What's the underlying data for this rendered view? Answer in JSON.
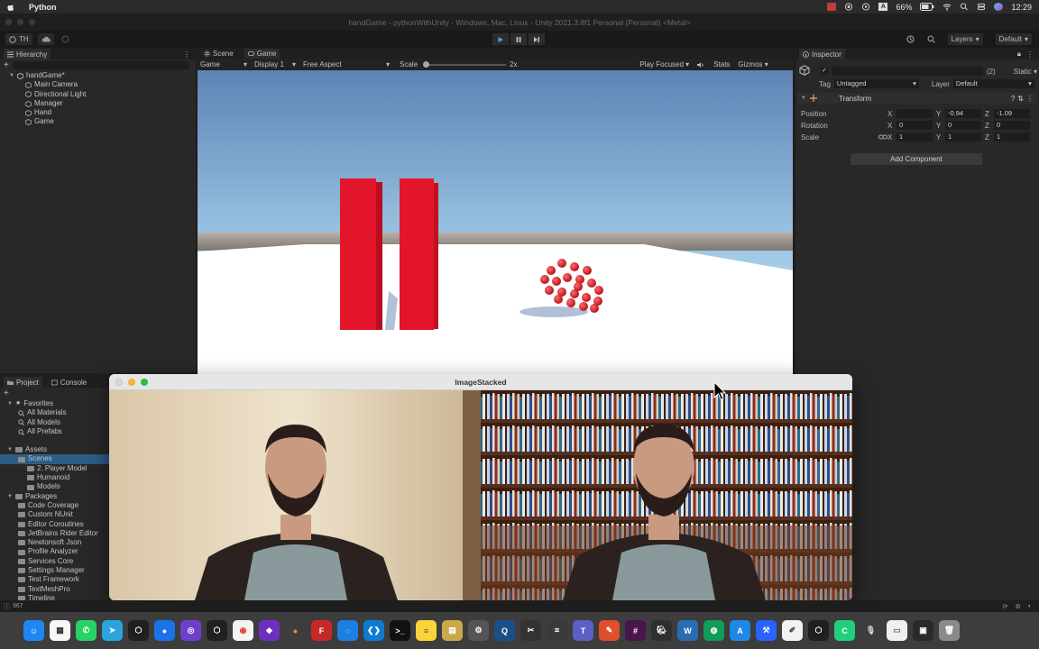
{
  "menubar": {
    "app_name": "Python",
    "battery": "66%",
    "clock": "12:29"
  },
  "window_title": "handGame - pythonWithUnity - Windows, Mac, Linux - Unity 2021.3.8f1 Personal (Personal) <Metal>",
  "toolbar": {
    "account": "TH",
    "layers": "Layers",
    "layout": "Default"
  },
  "hierarchy": {
    "tab": "Hierarchy",
    "scene": "handGame*",
    "items": [
      "Main Camera",
      "Directional Light",
      "Manager",
      "Hand",
      "Game"
    ]
  },
  "scene_tabs": {
    "scene": "Scene",
    "game": "Game"
  },
  "game_bar": {
    "mode": "Game",
    "display": "Display 1",
    "aspect": "Free Aspect",
    "scale_label": "Scale",
    "scale_value": "2x",
    "play_focused": "Play Focused",
    "stats": "Stats",
    "gizmos": "Gizmos"
  },
  "inspector": {
    "tab": "Inspector",
    "count": "(2)",
    "static": "Static",
    "tag_label": "Tag",
    "tag_value": "Untagged",
    "layer_label": "Layer",
    "layer_value": "Default",
    "component": "Transform",
    "position_label": "Position",
    "position": {
      "x": "",
      "y": "-0.94",
      "z": "-1.09"
    },
    "rotation_label": "Rotation",
    "rotation": {
      "x": "0",
      "y": "0",
      "z": "0"
    },
    "scale_label": "Scale",
    "scale": {
      "x": "1",
      "y": "1",
      "z": "1"
    },
    "add_component": "Add Component"
  },
  "project": {
    "tab_project": "Project",
    "tab_console": "Console",
    "favorites": "Favorites",
    "favorite_items": [
      "All Materials",
      "All Models",
      "All Prefabs"
    ],
    "assets": "Assets",
    "asset_items": [
      "Scenes",
      "2. Player Model",
      "Humanoid",
      "Models"
    ],
    "packages": "Packages",
    "package_items": [
      "Code Coverage",
      "Custom NUnit",
      "Editor Coroutines",
      "JetBrains Rider Editor",
      "Newtonsoft Json",
      "Profile Analyzer",
      "Services Core",
      "Settings Manager",
      "Test Framework",
      "TextMeshPro",
      "Timeline"
    ]
  },
  "image_window": {
    "title": "ImageStacked"
  },
  "status": {
    "count": "967"
  },
  "colors": {
    "accent_blue": "#2c5d87",
    "cube_red": "#e3152a",
    "sky_top": "#5e84b6",
    "sky_horizon": "#c9e4f3"
  }
}
